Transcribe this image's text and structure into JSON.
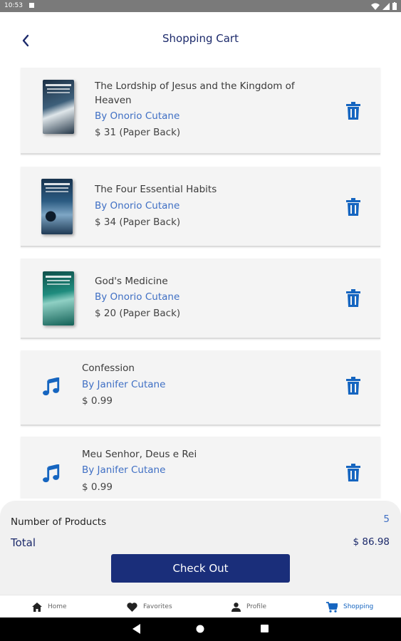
{
  "status_bar": {
    "time": "10:53"
  },
  "header": {
    "title": "Shopping Cart",
    "back_icon": "chevron-left-icon"
  },
  "items": [
    {
      "title": "The Lordship of Jesus and the Kingdom of Heaven",
      "author": "By Onorio Cutane",
      "price": "$ 31 (Paper Back)",
      "kind": "book"
    },
    {
      "title": "The Four Essential Habits",
      "author": "By Onorio Cutane",
      "price": "$ 34 (Paper Back)",
      "kind": "book"
    },
    {
      "title": "God's Medicine",
      "author": "By Onorio Cutane",
      "price": "$ 20 (Paper Back)",
      "kind": "book"
    },
    {
      "title": "Confession",
      "author": "By Janifer Cutane",
      "price": "$ 0.99",
      "kind": "music"
    },
    {
      "title": "Meu Senhor, Deus e Rei",
      "author": "By Janifer Cutane",
      "price": "$ 0.99",
      "kind": "music"
    }
  ],
  "summary": {
    "products_label": "Number of Products",
    "products_count": "5",
    "total_label": "Total",
    "total_value": "$ 86.98",
    "checkout_label": "Check Out"
  },
  "nav": [
    {
      "label": "Home",
      "icon": "home-icon"
    },
    {
      "label": "Favorites",
      "icon": "heart-icon"
    },
    {
      "label": "Profile",
      "icon": "person-icon"
    },
    {
      "label": "Shopping",
      "icon": "cart-icon",
      "active": true
    }
  ],
  "colors": {
    "accent": "#1565c0",
    "primary": "#1a2e7a",
    "author": "#3f6fc4",
    "card": "#f4f4f4"
  }
}
